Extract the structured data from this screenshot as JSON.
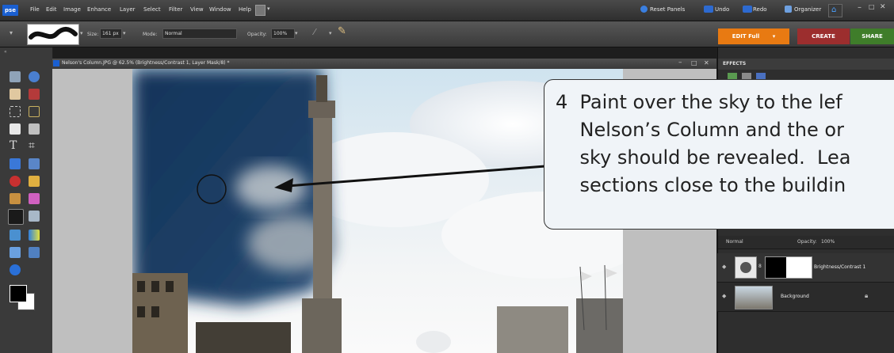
{
  "app": {
    "logo_text": "pse"
  },
  "menu": [
    "File",
    "Edit",
    "Image",
    "Enhance",
    "Layer",
    "Select",
    "Filter",
    "View",
    "Window",
    "Help"
  ],
  "top_actions": {
    "reset_panels": "Reset Panels",
    "undo": "Undo",
    "redo": "Redo",
    "organizer": "Organizer"
  },
  "options_bar": {
    "size_label": "Size:",
    "size_value": "161 px",
    "mode_label": "Mode:",
    "mode_value": "Normal",
    "opacity_label": "Opacity:",
    "opacity_value": "100%"
  },
  "mode_tabs": {
    "edit": "EDIT Full",
    "create": "CREATE",
    "share": "SHARE"
  },
  "document": {
    "title": "Nelson's Column.JPG @ 62.5% (Brightness/Contrast 1, Layer Mask/8) *"
  },
  "panels": {
    "effects_title": "EFFECTS",
    "blend_mode": "Normal",
    "opacity_label": "Opacity:",
    "opacity_value": "100%",
    "layers": [
      {
        "name": "Brightness/Contrast 1"
      },
      {
        "name": "Background"
      }
    ]
  },
  "callout": {
    "line1": "4  Paint over the sky to the lef",
    "line2": "    Nelson’s Column and the or",
    "line3": "    sky should be revealed.  Lea",
    "line4": "    sections close to the buildin"
  },
  "colors": {
    "edit_tab": "#e87a12",
    "create_tab": "#9c2e2e",
    "share_tab": "#3f7d2a",
    "accent": "#1a5fd0",
    "sky_masked": "#1d3f66"
  }
}
